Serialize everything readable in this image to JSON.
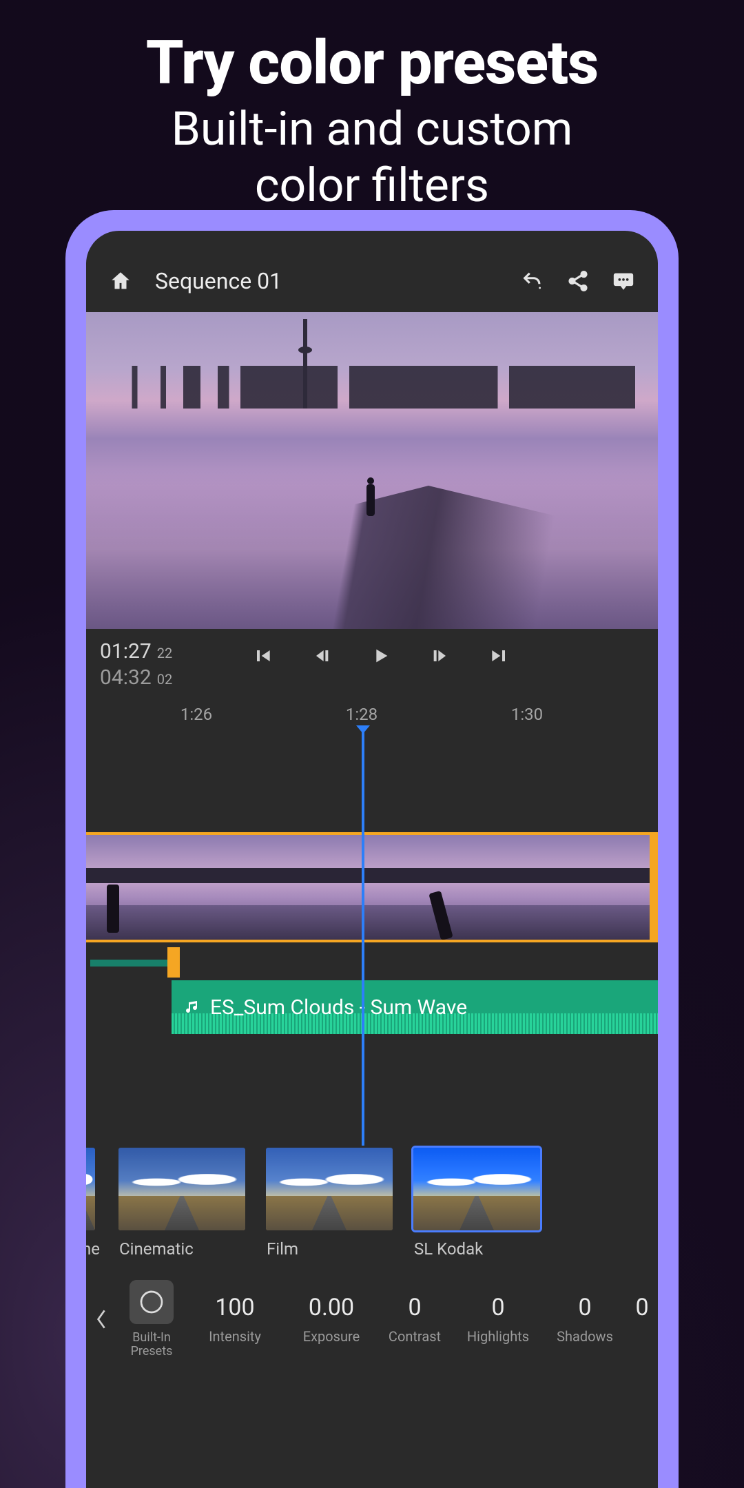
{
  "promo": {
    "title": "Try color presets",
    "subtitle_line1": "Built-in and custom",
    "subtitle_line2": "color filters"
  },
  "header": {
    "title": "Sequence 01"
  },
  "transport": {
    "current_time": "01:27",
    "current_frames": "22",
    "total_time": "04:32",
    "total_frames": "02"
  },
  "ruler": {
    "t1": "1:26",
    "t2": "1:28",
    "t3": "1:30"
  },
  "audio": {
    "label": "ES_Sum Clouds - Sum Wave"
  },
  "presets": {
    "items": [
      {
        "label": "one"
      },
      {
        "label": "Cinematic"
      },
      {
        "label": "Film"
      },
      {
        "label": "SL Kodak"
      }
    ]
  },
  "adjust": {
    "builtin_label_l1": "Built-In",
    "builtin_label_l2": "Presets",
    "items": [
      {
        "value": "100",
        "label": "Intensity"
      },
      {
        "value": "0.00",
        "label": "Exposure"
      },
      {
        "value": "0",
        "label": "Contrast"
      },
      {
        "value": "0",
        "label": "Highlights"
      },
      {
        "value": "0",
        "label": "Shadows"
      },
      {
        "value": "0",
        "label": ""
      }
    ]
  }
}
